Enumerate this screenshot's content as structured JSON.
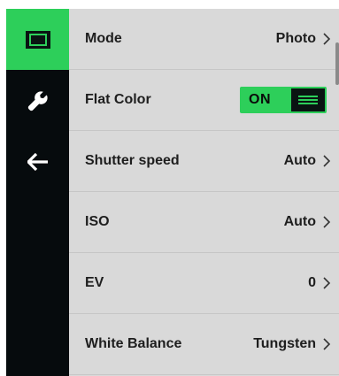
{
  "sidebar": {
    "items": [
      {
        "icon": "camera-icon",
        "active": true
      },
      {
        "icon": "wrench-icon",
        "active": false
      },
      {
        "icon": "back-arrow-icon",
        "active": false
      }
    ]
  },
  "menu": {
    "rows": [
      {
        "label": "Mode",
        "value": "Photo"
      },
      {
        "label": "Flat Color",
        "toggle": "ON"
      },
      {
        "label": "Shutter speed",
        "value": "Auto"
      },
      {
        "label": "ISO",
        "value": "Auto"
      },
      {
        "label": "EV",
        "value": "0"
      },
      {
        "label": "White Balance",
        "value": "Tungsten"
      }
    ]
  },
  "colors": {
    "accent": "#2dcf5a",
    "sidebar_bg": "#060b0d",
    "menu_bg": "#d9d9d9"
  }
}
